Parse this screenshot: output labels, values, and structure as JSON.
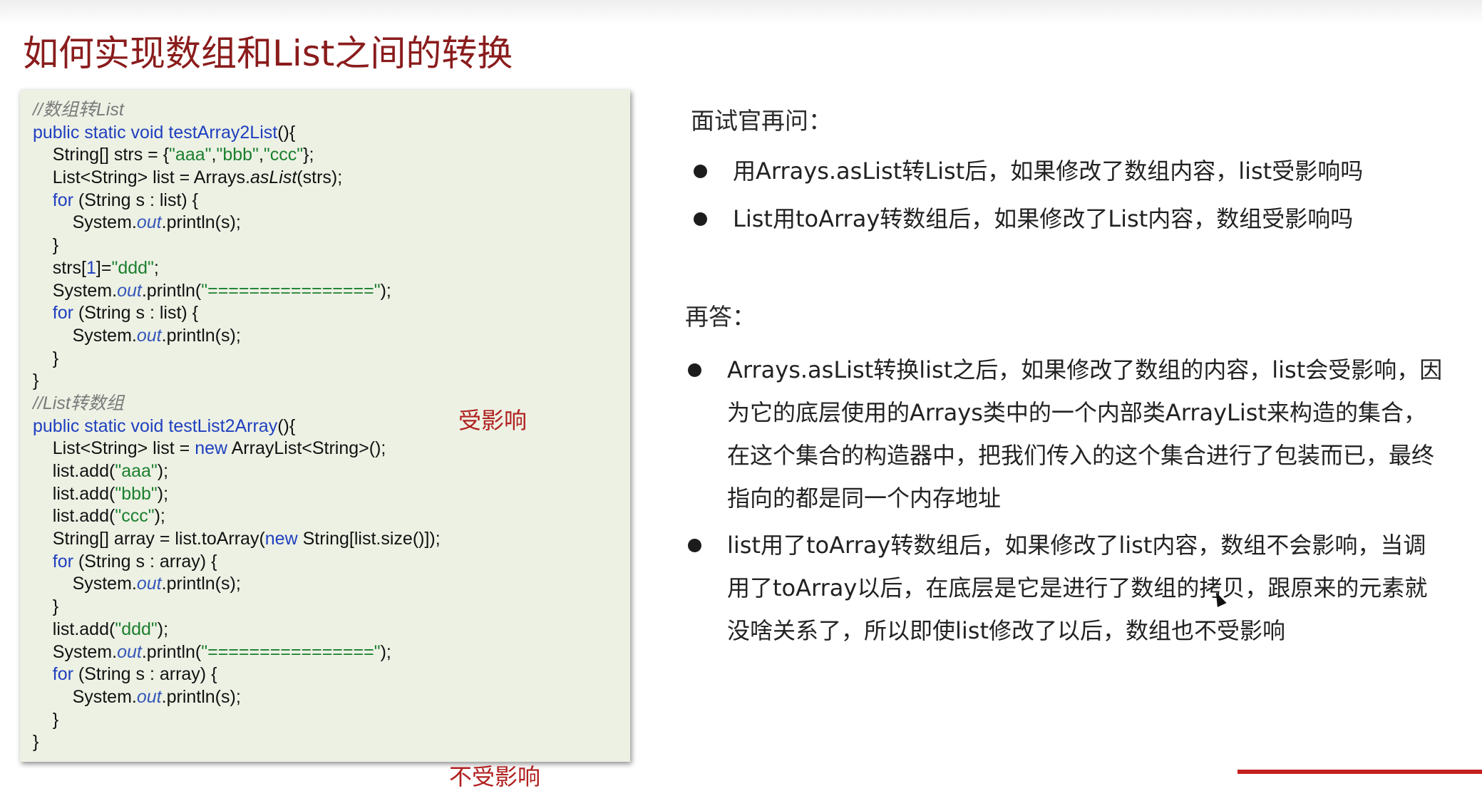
{
  "title": "如何实现数组和List之间的转换",
  "code_lines": [
    [
      {
        "t": "//数组转List",
        "c": "comment"
      }
    ],
    [
      {
        "t": "public static void ",
        "c": "kw"
      },
      {
        "t": "testArray2List",
        "c": "method"
      },
      {
        "t": "(){",
        "c": "plain"
      }
    ],
    [
      {
        "t": "    String[] strs = {",
        "c": "plain"
      },
      {
        "t": "\"aaa\"",
        "c": "str"
      },
      {
        "t": ",",
        "c": "plain"
      },
      {
        "t": "\"bbb\"",
        "c": "str"
      },
      {
        "t": ",",
        "c": "plain"
      },
      {
        "t": "\"ccc\"",
        "c": "str"
      },
      {
        "t": "};",
        "c": "plain"
      }
    ],
    [
      {
        "t": "    List<String> list = Arrays.",
        "c": "plain"
      },
      {
        "t": "asList",
        "c": "italic"
      },
      {
        "t": "(strs);",
        "c": "plain"
      }
    ],
    [
      {
        "t": "    ",
        "c": "plain"
      },
      {
        "t": "for",
        "c": "kw"
      },
      {
        "t": " (String s : list) {",
        "c": "plain"
      }
    ],
    [
      {
        "t": "        System.",
        "c": "plain"
      },
      {
        "t": "out",
        "c": "field"
      },
      {
        "t": ".println(s);",
        "c": "plain"
      }
    ],
    [
      {
        "t": "    }",
        "c": "plain"
      }
    ],
    [
      {
        "t": "    strs[",
        "c": "plain"
      },
      {
        "t": "1",
        "c": "num"
      },
      {
        "t": "]=",
        "c": "plain"
      },
      {
        "t": "\"ddd\"",
        "c": "str"
      },
      {
        "t": ";",
        "c": "plain"
      }
    ],
    [
      {
        "t": "    System.",
        "c": "plain"
      },
      {
        "t": "out",
        "c": "field"
      },
      {
        "t": ".println(",
        "c": "plain"
      },
      {
        "t": "\"================\"",
        "c": "str"
      },
      {
        "t": ");",
        "c": "plain"
      }
    ],
    [
      {
        "t": "    ",
        "c": "plain"
      },
      {
        "t": "for",
        "c": "kw"
      },
      {
        "t": " (String s : list) {",
        "c": "plain"
      }
    ],
    [
      {
        "t": "        System.",
        "c": "plain"
      },
      {
        "t": "out",
        "c": "field"
      },
      {
        "t": ".println(s);",
        "c": "plain"
      }
    ],
    [
      {
        "t": "    }",
        "c": "plain"
      }
    ],
    [
      {
        "t": "}",
        "c": "plain"
      }
    ],
    [
      {
        "t": "//List转数组",
        "c": "comment"
      }
    ],
    [
      {
        "t": "public static void ",
        "c": "kw"
      },
      {
        "t": "testList2Array",
        "c": "method"
      },
      {
        "t": "(){",
        "c": "plain"
      }
    ],
    [
      {
        "t": "    List<String> list = ",
        "c": "plain"
      },
      {
        "t": "new",
        "c": "kw"
      },
      {
        "t": " ArrayList<String>();",
        "c": "plain"
      }
    ],
    [
      {
        "t": "    list.add(",
        "c": "plain"
      },
      {
        "t": "\"aaa\"",
        "c": "str"
      },
      {
        "t": ");",
        "c": "plain"
      }
    ],
    [
      {
        "t": "    list.add(",
        "c": "plain"
      },
      {
        "t": "\"bbb\"",
        "c": "str"
      },
      {
        "t": ");",
        "c": "plain"
      }
    ],
    [
      {
        "t": "    list.add(",
        "c": "plain"
      },
      {
        "t": "\"ccc\"",
        "c": "str"
      },
      {
        "t": ");",
        "c": "plain"
      }
    ],
    [
      {
        "t": "    String[] array = list.toArray(",
        "c": "plain"
      },
      {
        "t": "new",
        "c": "kw"
      },
      {
        "t": " String[list.size()]);",
        "c": "plain"
      }
    ],
    [
      {
        "t": "    ",
        "c": "plain"
      },
      {
        "t": "for",
        "c": "kw"
      },
      {
        "t": " (String s : array) {",
        "c": "plain"
      }
    ],
    [
      {
        "t": "        System.",
        "c": "plain"
      },
      {
        "t": "out",
        "c": "field"
      },
      {
        "t": ".println(s);",
        "c": "plain"
      }
    ],
    [
      {
        "t": "    }",
        "c": "plain"
      }
    ],
    [
      {
        "t": "    list.add(",
        "c": "plain"
      },
      {
        "t": "\"ddd\"",
        "c": "str"
      },
      {
        "t": ");",
        "c": "plain"
      }
    ],
    [
      {
        "t": "    System.",
        "c": "plain"
      },
      {
        "t": "out",
        "c": "field"
      },
      {
        "t": ".println(",
        "c": "plain"
      },
      {
        "t": "\"================\"",
        "c": "str"
      },
      {
        "t": ");",
        "c": "plain"
      }
    ],
    [
      {
        "t": "    ",
        "c": "plain"
      },
      {
        "t": "for",
        "c": "kw"
      },
      {
        "t": " (String s : array) {",
        "c": "plain"
      }
    ],
    [
      {
        "t": "        System.",
        "c": "plain"
      },
      {
        "t": "out",
        "c": "field"
      },
      {
        "t": ".println(s);",
        "c": "plain"
      }
    ],
    [
      {
        "t": "    }",
        "c": "plain"
      }
    ],
    [
      {
        "t": "}",
        "c": "plain"
      }
    ]
  ],
  "annotations": {
    "affected": "受影响",
    "unaffected": "不受影响"
  },
  "question_label": "面试官再问：",
  "questions": [
    "用Arrays.asList转List后，如果修改了数组内容，list受影响吗",
    "List用toArray转数组后，如果修改了List内容，数组受影响吗"
  ],
  "answer_label": "再答：",
  "answers": [
    "Arrays.asList转换list之后，如果修改了数组的内容，list会受影响，因为它的底层使用的Arrays类中的一个内部类ArrayList来构造的集合，在这个集合的构造器中，把我们传入的这个集合进行了包装而已，最终指向的都是同一个内存地址",
    "list用了toArray转数组后，如果修改了list内容，数组不会影响，当调用了toArray以后，在底层是它是进行了数组的拷贝，跟原来的元素就没啥关系了，所以即使list修改了以后，数组也不受影响"
  ],
  "colors": {
    "title": "#8a1c1c",
    "annotation": "#b0201f",
    "code_background": "#edf1e4",
    "keyword": "#1f3fbf",
    "string": "#1b7f2e",
    "comment": "#7a7a7a",
    "accent_bar": "#c42020"
  }
}
